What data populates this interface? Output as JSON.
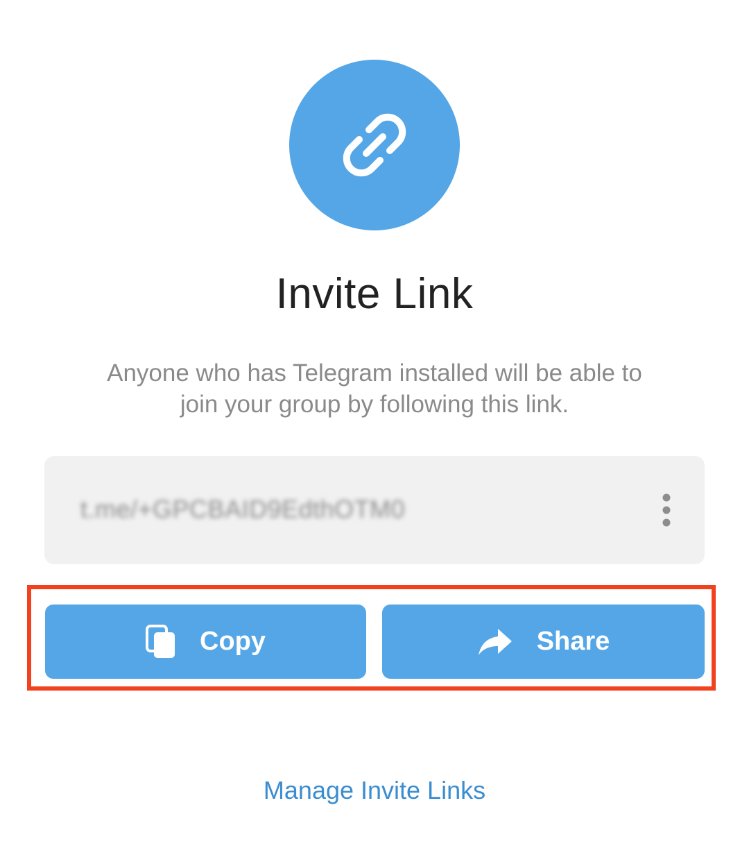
{
  "header": {
    "icon": "link-icon",
    "title": "Invite Link",
    "description": "Anyone who has Telegram installed will be able to join your group by following this link."
  },
  "link": {
    "url": "t.me/+GPCBAID9EdthOTM0",
    "more_icon": "more-vertical-icon"
  },
  "actions": {
    "copy_label": "Copy",
    "copy_icon": "copy-icon",
    "share_label": "Share",
    "share_icon": "share-arrow-icon"
  },
  "footer": {
    "manage_label": "Manage Invite Links"
  },
  "colors": {
    "accent": "#54a6e6",
    "highlight": "#f1411f",
    "link_text": "#3b8dd0"
  }
}
